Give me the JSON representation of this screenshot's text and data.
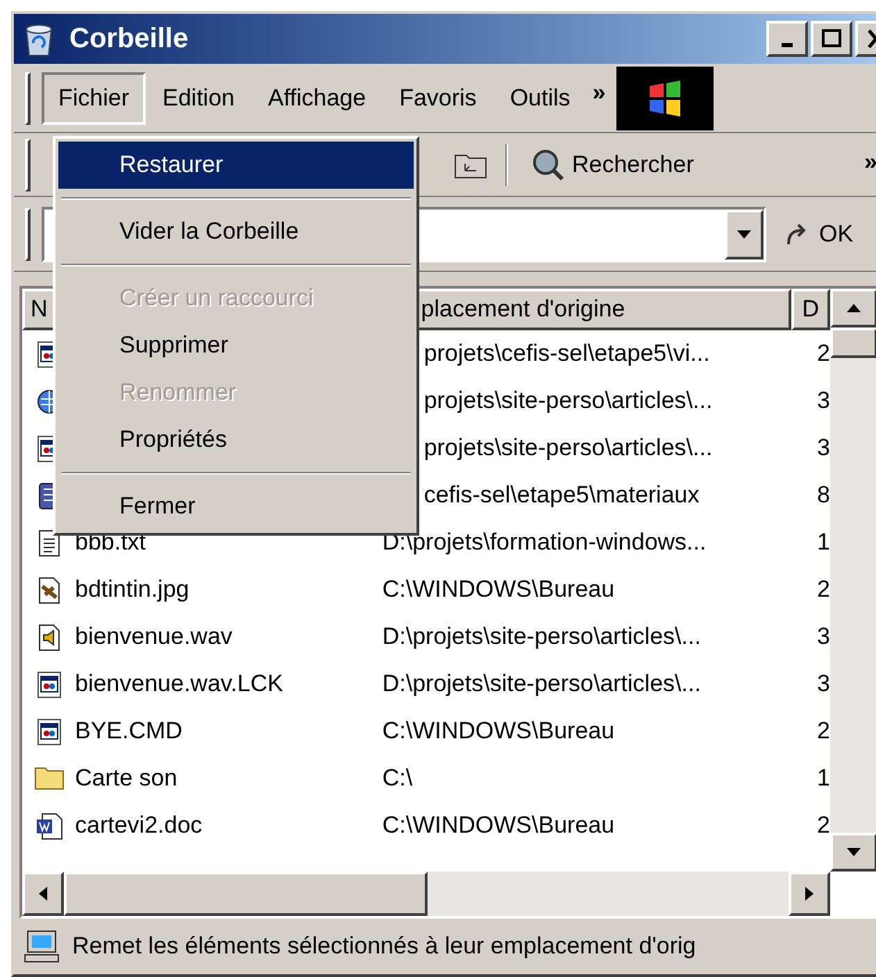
{
  "window": {
    "title": "Corbeille"
  },
  "menu_bar": {
    "items": [
      {
        "label": "Fichier",
        "selected": true
      },
      {
        "label": "Edition",
        "selected": false
      },
      {
        "label": "Affichage",
        "selected": false
      },
      {
        "label": "Favoris",
        "selected": false
      },
      {
        "label": "Outils",
        "selected": false
      }
    ],
    "overflow": "»"
  },
  "toolbar": {
    "search_label": "Rechercher",
    "overflow": "»"
  },
  "address_bar": {
    "go_label": "OK"
  },
  "file_menu": {
    "items": [
      {
        "kind": "item",
        "label": "Restaurer",
        "selected": true,
        "disabled": false
      },
      {
        "kind": "separator"
      },
      {
        "kind": "item",
        "label": "Vider la Corbeille",
        "selected": false,
        "disabled": false
      },
      {
        "kind": "separator"
      },
      {
        "kind": "item",
        "label": "Créer un raccourci",
        "selected": false,
        "disabled": true
      },
      {
        "kind": "item",
        "label": "Supprimer",
        "selected": false,
        "disabled": false
      },
      {
        "kind": "item",
        "label": "Renommer",
        "selected": false,
        "disabled": true
      },
      {
        "kind": "item",
        "label": "Propriétés",
        "selected": false,
        "disabled": false
      },
      {
        "kind": "separator"
      },
      {
        "kind": "item",
        "label": "Fermer",
        "selected": false,
        "disabled": false
      }
    ]
  },
  "table": {
    "columns": [
      "N",
      "placement d'origine",
      "D"
    ],
    "rows": [
      {
        "kind": "app",
        "path": "projets\\cefis-sel\\etape5\\vi...",
        "column_3": "2"
      },
      {
        "kind": "globe",
        "path": "projets\\site-perso\\articles\\...",
        "column_3": "3"
      },
      {
        "kind": "app",
        "path": "projets\\site-perso\\articles\\...",
        "column_3": "3"
      },
      {
        "kind": "notebook",
        "path": "cefis-sel\\etape5\\materiaux",
        "column_3": "8"
      },
      {
        "kind": "text",
        "name": "bbb.txt",
        "path": "D:\\projets\\formation-windows...",
        "column_3": "1"
      },
      {
        "kind": "image",
        "name": "bdtintin.jpg",
        "path": "C:\\WINDOWS\\Bureau",
        "column_3": "2"
      },
      {
        "kind": "sound",
        "name": "bienvenue.wav",
        "path": "D:\\projets\\site-perso\\articles\\...",
        "column_3": "3"
      },
      {
        "kind": "app",
        "name": "bienvenue.wav.LCK",
        "path": "D:\\projets\\site-perso\\articles\\...",
        "column_3": "3"
      },
      {
        "kind": "app",
        "name": "BYE.CMD",
        "path": "C:\\WINDOWS\\Bureau",
        "column_3": "2"
      },
      {
        "kind": "folder",
        "name": "Carte son",
        "path": "C:\\",
        "column_3": "1"
      },
      {
        "kind": "word",
        "name": "cartevi2.doc",
        "path": "C:\\WINDOWS\\Bureau",
        "column_3": "2"
      }
    ]
  },
  "status_bar": {
    "text": "Remet les éléments sélectionnés à leur emplacement d'orig"
  }
}
